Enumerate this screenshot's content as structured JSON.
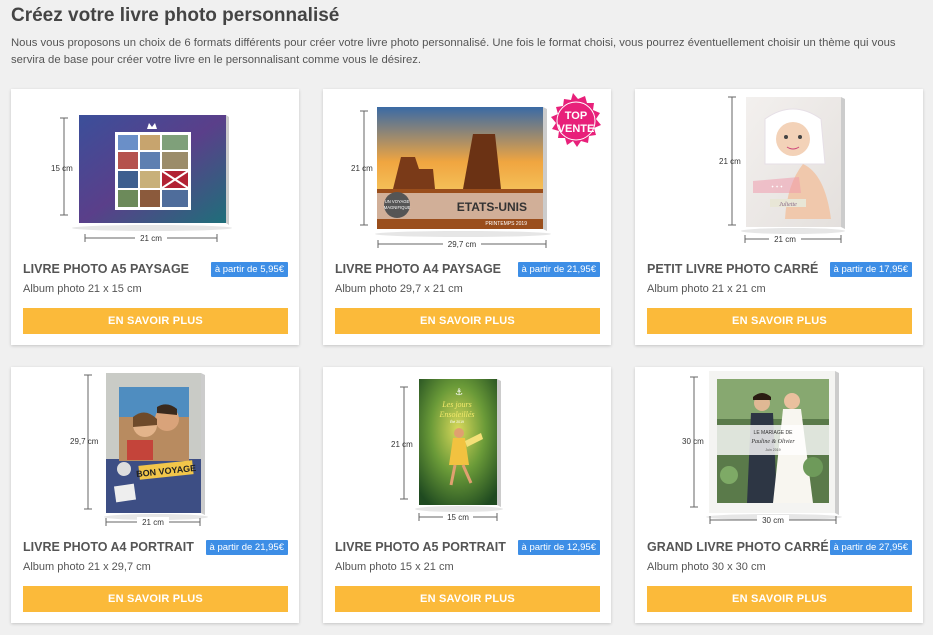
{
  "page": {
    "title": "Créez votre livre photo personnalisé",
    "intro": "Nous vous proposons un choix de 6 formats différents pour créer votre livre photo personnalisé. Une fois le format choisi, vous pourrez éventuellement choisir un thème qui vous servira de base pour créer votre livre en le personnalisant comme vous le désirez."
  },
  "colors": {
    "accent": "#fbba3a",
    "badge": "#3d8ee6",
    "top_vente": "#e8207a"
  },
  "products": [
    {
      "title": "LIVRE PHOTO A5 PAYSAGE",
      "price": "à partir de 5,95€",
      "subtitle": "Album photo 21 x 15 cm",
      "cta": "EN SAVOIR PLUS",
      "dim_h": "15 cm",
      "dim_w": "21 cm"
    },
    {
      "title": "LIVRE PHOTO A4 PAYSAGE",
      "price": "à partir de 21,95€",
      "subtitle": "Album photo 29,7 x 21 cm",
      "cta": "EN SAVOIR PLUS",
      "dim_h": "21 cm",
      "dim_w": "29,7 cm",
      "ribbon_line1": "TOP",
      "ribbon_line2": "VENTE",
      "cover_text": "ETATS-UNIS",
      "cover_small": "PRINTEMPS 2019",
      "cover_badge1": "UN VOYAGE",
      "cover_badge2": "MAGNIFIQUE"
    },
    {
      "title": "PETIT LIVRE PHOTO CARRÉ",
      "price": "à partir de 17,95€",
      "subtitle": "Album photo 21 x 21 cm",
      "cta": "EN SAVOIR PLUS",
      "dim_h": "21 cm",
      "dim_w": "21 cm",
      "cover_text": "Juliette"
    },
    {
      "title": "LIVRE PHOTO A4 PORTRAIT",
      "price": "à partir de 21,95€",
      "subtitle": "Album photo 21 x 29,7 cm",
      "cta": "EN SAVOIR PLUS",
      "dim_h": "29,7 cm",
      "dim_w": "21 cm",
      "cover_text": "BON VOYAGE"
    },
    {
      "title": "LIVRE PHOTO A5 PORTRAIT",
      "price": "à partir de 12,95€",
      "subtitle": "Album photo 15 x 21 cm",
      "cta": "EN SAVOIR PLUS",
      "dim_h": "21 cm",
      "dim_w": "15 cm",
      "cover_text1": "Les jours",
      "cover_text2": "Ensoleillés",
      "cover_small": "Été 2019"
    },
    {
      "title": "GRAND LIVRE PHOTO CARRÉ",
      "price": "à partir de 27,95€",
      "subtitle": "Album photo 30 x 30 cm",
      "cta": "EN SAVOIR PLUS",
      "dim_h": "30 cm",
      "dim_w": "30 cm",
      "cover_text1": "LE MARIAGE DE",
      "cover_text2": "Pauline & Olivier",
      "cover_small": "Juin 2019"
    }
  ]
}
